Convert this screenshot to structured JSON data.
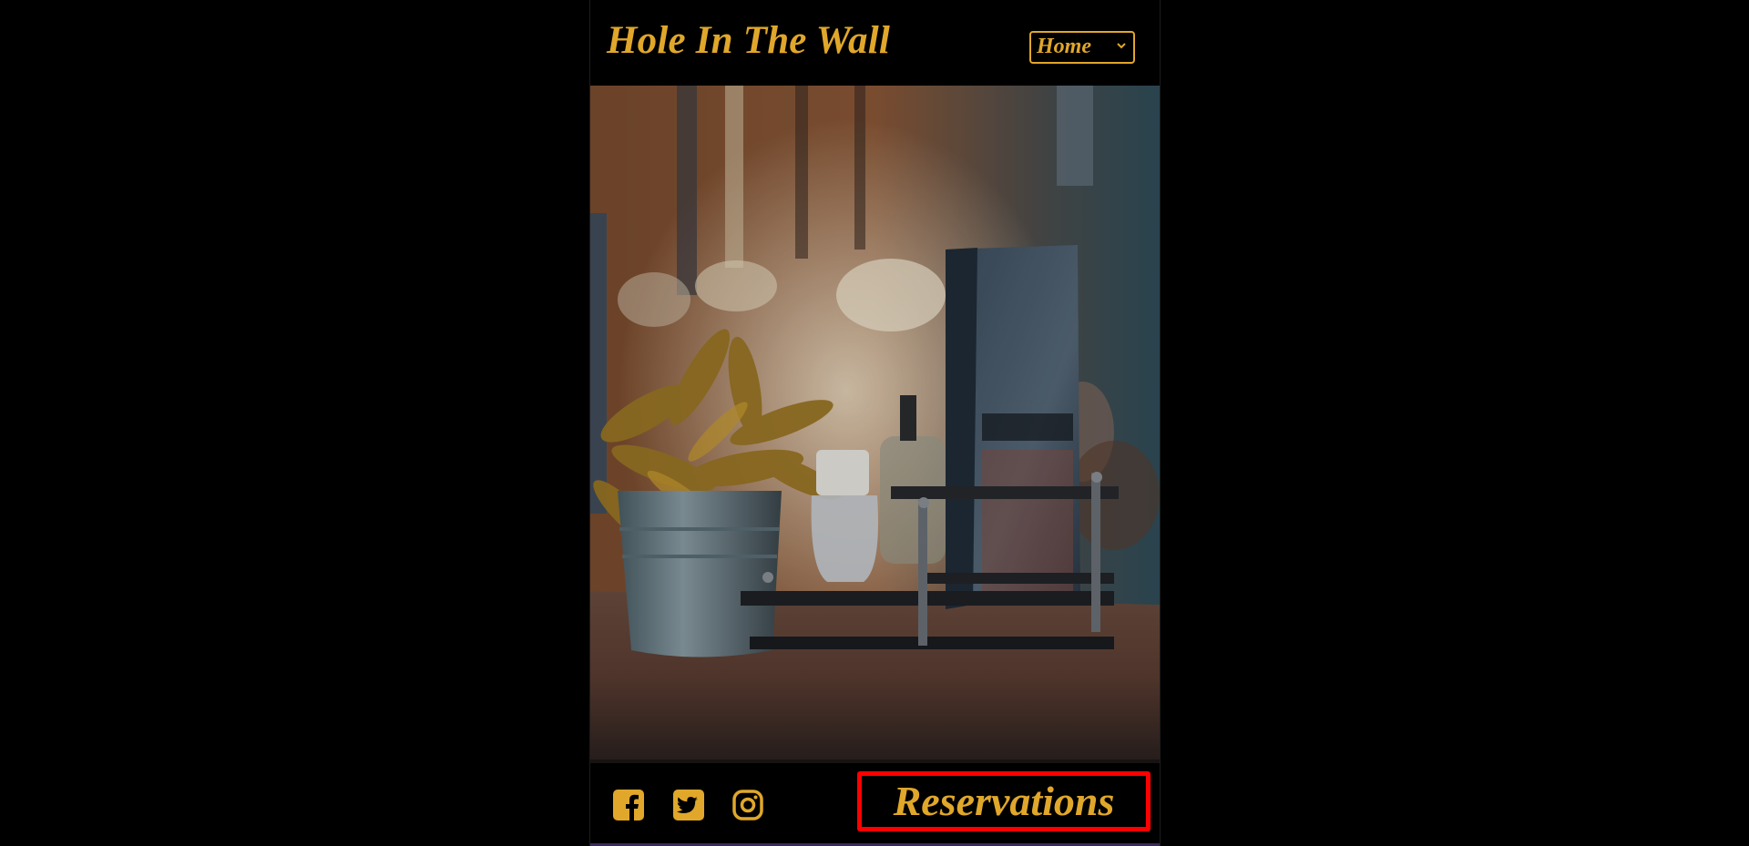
{
  "header": {
    "brand": "Hole In The Wall",
    "nav_selected": "Home"
  },
  "hero": {
    "image": "restaurant-table-photo"
  },
  "footer": {
    "social": [
      {
        "icon": "facebook-icon"
      },
      {
        "icon": "twitter-icon"
      },
      {
        "icon": "instagram-icon"
      }
    ],
    "reservations_label": "Reservations"
  },
  "colors": {
    "accent": "#e0a72a",
    "background": "#000000",
    "highlight": "#ff0000"
  }
}
